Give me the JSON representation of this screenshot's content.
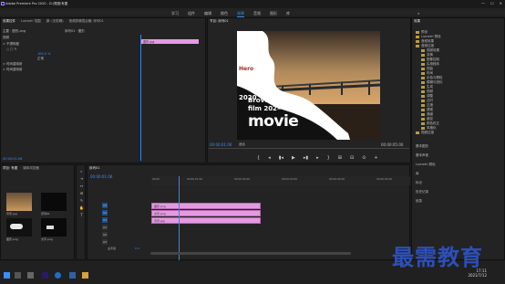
{
  "titlebar": {
    "title": "Adobe Premiere Pro 2020 - D:\\秀图\\有图",
    "minimize": "—",
    "maximize": "☐",
    "close": "✕"
  },
  "workspaces": {
    "items": [
      "学习",
      "组件",
      "编辑",
      "颜色",
      "效果",
      "音频",
      "图形",
      "库"
    ],
    "active_index": 4,
    "right": "»"
  },
  "effect_controls": {
    "tabs": [
      "效果控件",
      "Lumetri 范围",
      "源: (无剪辑)",
      "音频剪辑混合器: 序列01"
    ],
    "source": "主要 · 图形.png",
    "sequence": "序列01 · 图形",
    "rows": [
      "视频",
      "> 不透明度",
      "○ □ ✎",
      "> 时间重映射",
      "> 时间重映射"
    ],
    "values": [
      "100.0 %",
      "正常"
    ],
    "clip_bar_label": "图形.jpg",
    "timecode": "00:00:01:06"
  },
  "program": {
    "tab": "节目: 序列01",
    "video_text": {
      "hero": "Hero",
      "year": "2020",
      "line1": "Brove 0",
      "line2": "film 202—",
      "movie": "movie"
    },
    "timecode_left": "00:00:01:06",
    "fit": "适合",
    "timecode_right": "00:00:05:00",
    "controls": [
      "{",
      "◂",
      "▮◂",
      "▶",
      "▸▮",
      "▸",
      "}",
      "⊞",
      "⊟",
      "⊙",
      "+"
    ]
  },
  "project": {
    "tabs": [
      "项目: 有图",
      "媒体浏览器"
    ],
    "items": [
      {
        "label": "背景.jpg",
        "type": "image"
      },
      {
        "label": "序列01",
        "type": "sequence"
      },
      {
        "label": "图形.png",
        "type": "image"
      },
      {
        "label": "文字.png",
        "type": "image"
      }
    ]
  },
  "tools": [
    "▸",
    "⇥",
    "↔",
    "⊞",
    "✎",
    "✋",
    "T"
  ],
  "timeline": {
    "tab": "序列01",
    "timecode": "00:00:01:06",
    "ruler": [
      "00:00",
      "00:00:01:00",
      "00:00:02:00",
      "00:00:03:00",
      "00:00:04:00",
      "00:00:05:00"
    ],
    "tracks": [
      {
        "name": "V3",
        "clip": "图形.png"
      },
      {
        "name": "V2",
        "clip": "文字.png"
      },
      {
        "name": "V1",
        "clip": "背景.jpg"
      },
      {
        "name": "A1",
        "clip": ""
      },
      {
        "name": "A2",
        "clip": ""
      },
      {
        "name": "A3",
        "clip": ""
      },
      {
        "name": "主声道",
        "clip": "0.0"
      }
    ]
  },
  "libraries": {
    "tab": "效果",
    "items": [
      "预设",
      "Lumetri 预设",
      "音频效果",
      "音频过渡",
      "视频效果",
      "变换",
      "图像控制",
      "实用程序",
      "扭曲",
      "时间",
      "杂色与颗粒",
      "模糊与锐化",
      "生成",
      "视频",
      "调整",
      "过时",
      "过渡",
      "透视",
      "通道",
      "键控",
      "颜色校正",
      "风格化",
      "视频过渡"
    ],
    "bottom": [
      "基本图形",
      "基本声音",
      "Lumetri 颜色",
      "库",
      "标记",
      "历史记录",
      "信息"
    ]
  },
  "taskbar": {
    "time": "17:11",
    "date": "2021/7/12"
  },
  "watermark": "最需教育",
  "colors": {
    "accent": "#3a8ff2",
    "clip": "#e29be0",
    "panel": "#232323"
  }
}
